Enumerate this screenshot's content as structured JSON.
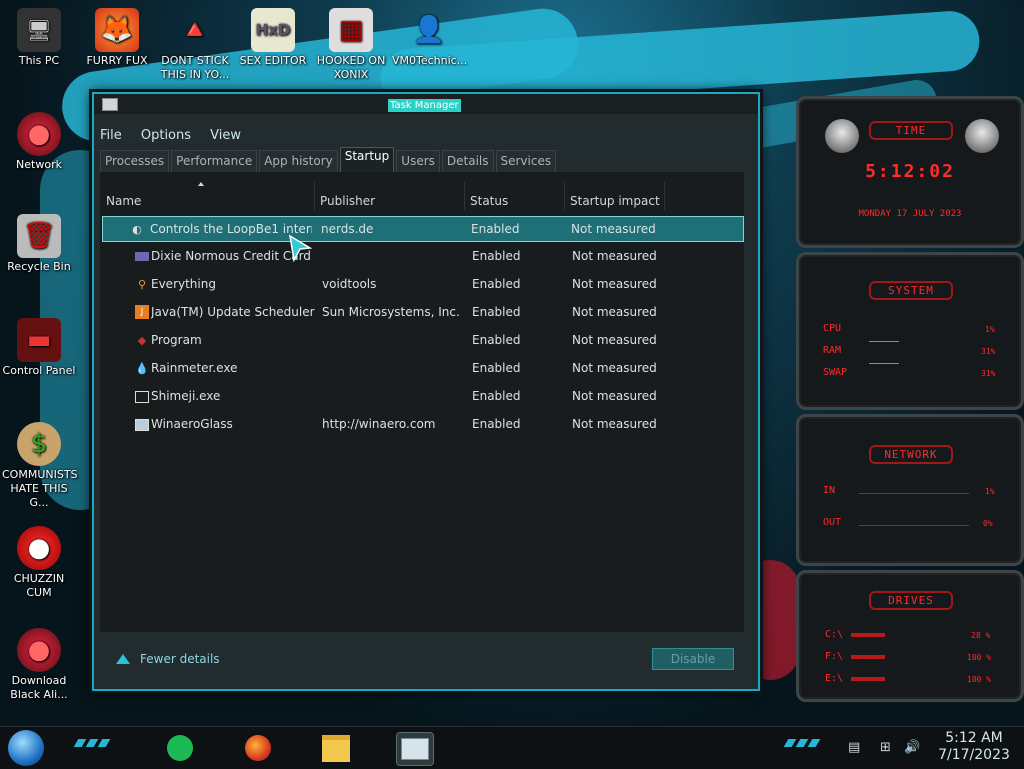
{
  "desktop": {
    "icons": [
      {
        "label": "This PC",
        "glyph": "🖥"
      },
      {
        "label": "FURRY FUX",
        "glyph": "🦊"
      },
      {
        "label": "DONT STICK THIS IN YO...",
        "glyph": "🔺"
      },
      {
        "label": "SEX EDITOR",
        "glyph": "HxD"
      },
      {
        "label": "HOOKED ON XONIX",
        "glyph": "▦"
      },
      {
        "label": "VM0Technic...",
        "glyph": "👤"
      },
      {
        "label": "Network",
        "glyph": "●"
      },
      {
        "label": "Recycle Bin",
        "glyph": "🗑"
      },
      {
        "label": "Control Panel",
        "glyph": "▬"
      },
      {
        "label": "COMMUNISTS HATE THIS G...",
        "glyph": "$"
      },
      {
        "label": "CHUZZIN CUM",
        "glyph": "●"
      },
      {
        "label": "Download Black Ali...",
        "glyph": "●"
      }
    ]
  },
  "task_manager": {
    "title": "Task Manager",
    "menu": [
      "File",
      "Options",
      "View"
    ],
    "tabs": [
      "Processes",
      "Performance",
      "App history",
      "Startup",
      "Users",
      "Details",
      "Services"
    ],
    "active_tab": "Startup",
    "columns": [
      "Name",
      "Publisher",
      "Status",
      "Startup impact"
    ],
    "rows": [
      {
        "name": "Controls the LoopBe1 intern...",
        "publisher": "nerds.de",
        "status": "Enabled",
        "impact": "Not measured",
        "icon": "loop-icon",
        "selected": true
      },
      {
        "name": "Dixie Normous Credit Card",
        "publisher": "",
        "status": "Enabled",
        "impact": "Not measured",
        "icon": "credit-card-icon",
        "selected": false
      },
      {
        "name": "Everything",
        "publisher": "voidtools",
        "status": "Enabled",
        "impact": "Not measured",
        "icon": "magnifier-icon",
        "selected": false
      },
      {
        "name": "Java(TM) Update Scheduler",
        "publisher": "Sun Microsystems, Inc.",
        "status": "Enabled",
        "impact": "Not measured",
        "icon": "java-icon",
        "selected": false
      },
      {
        "name": "Program",
        "publisher": "",
        "status": "Enabled",
        "impact": "Not measured",
        "icon": "program-icon",
        "selected": false
      },
      {
        "name": "Rainmeter.exe",
        "publisher": "",
        "status": "Enabled",
        "impact": "Not measured",
        "icon": "droplet-icon",
        "selected": false
      },
      {
        "name": "Shimeji.exe",
        "publisher": "",
        "status": "Enabled",
        "impact": "Not measured",
        "icon": "window-icon",
        "selected": false
      },
      {
        "name": "WinaeroGlass",
        "publisher": "http://winaero.com",
        "status": "Enabled",
        "impact": "Not measured",
        "icon": "glass-icon",
        "selected": false
      }
    ],
    "fewer_details": "Fewer details",
    "disable_button": "Disable"
  },
  "widgets": {
    "time": {
      "title": "TIME",
      "clock": "5:12:02",
      "date": "MONDAY 17 JULY 2023"
    },
    "system": {
      "title": "SYSTEM",
      "cpu_label": "CPU",
      "cpu_val": "1%",
      "ram_label": "RAM",
      "ram_val": "31%",
      "swap_label": "SWAP",
      "swap_val": "31%"
    },
    "network": {
      "title": "NETWORK",
      "in_label": "IN",
      "in_val": "1%",
      "out_label": "OUT",
      "out_val": "0%"
    },
    "drives": {
      "title": "DRIVES",
      "c_label": "C:\\",
      "c_val": "28 %",
      "f_label": "F:\\",
      "f_val": "100 %",
      "e_label": "E:\\",
      "e_val": "100 %"
    }
  },
  "taskbar": {
    "time": "5:12 AM",
    "date": "7/17/2023",
    "pinned": [
      "spotify-icon",
      "firefox-icon",
      "file-explorer-icon",
      "task-manager-icon"
    ]
  },
  "colors": {
    "accent": "#27b6d6",
    "widget_red": "#ff2a2a",
    "selection": "#1f6f76"
  }
}
